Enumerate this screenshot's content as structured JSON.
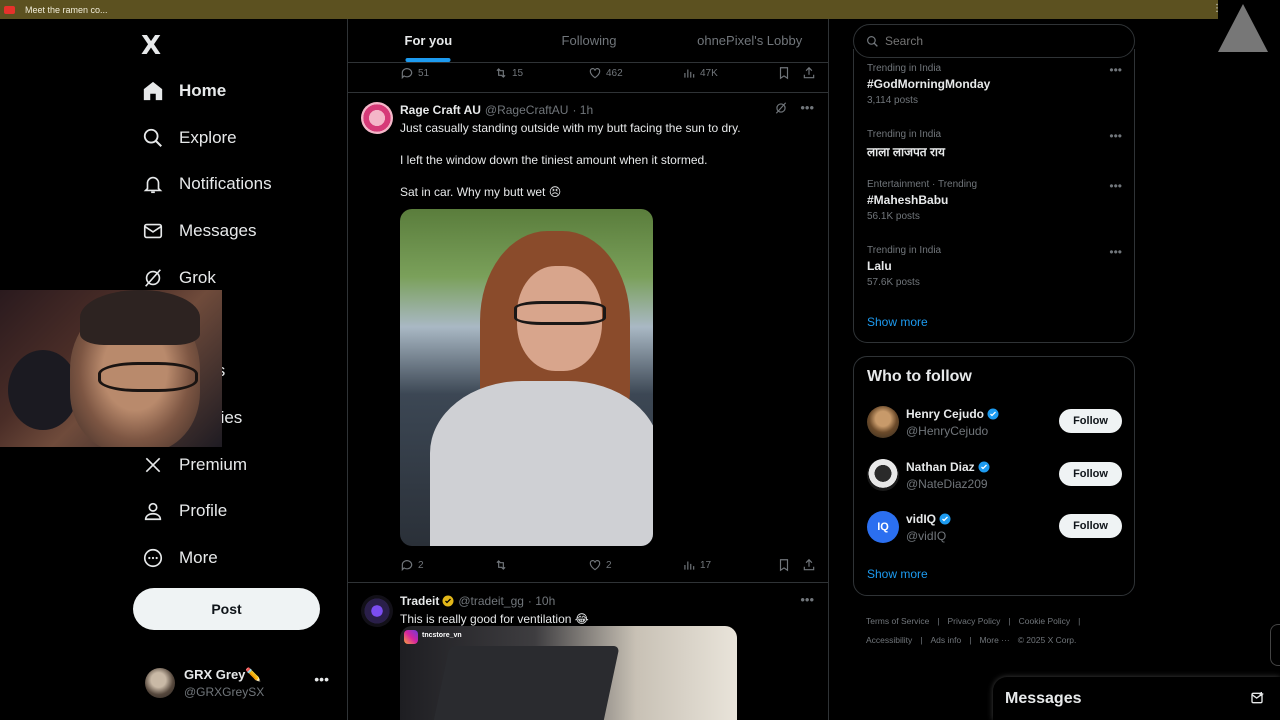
{
  "browser": {
    "tab_title": "Meet the ramen co..."
  },
  "nav": {
    "logo": "X",
    "items": [
      {
        "label": "Home",
        "icon": "home-icon"
      },
      {
        "label": "Explore",
        "icon": "search-icon"
      },
      {
        "label": "Notifications",
        "icon": "bell-icon"
      },
      {
        "label": "Messages",
        "icon": "mail-icon"
      },
      {
        "label": "Grok",
        "icon": "grok-icon"
      },
      {
        "label": "marks",
        "icon": "bookmark-icon"
      },
      {
        "label": "munities",
        "icon": "communities-icon"
      },
      {
        "label": "Premium",
        "icon": "x-icon"
      },
      {
        "label": "Profile",
        "icon": "person-icon"
      },
      {
        "label": "More",
        "icon": "more-circle-icon"
      }
    ],
    "post_label": "Post",
    "account": {
      "name": "GRX Grey✏️",
      "handle": "@GRXGreySX"
    }
  },
  "timeline": {
    "tabs": [
      "For you",
      "Following",
      "ohnePixel's Lobby"
    ],
    "prev_actions": {
      "replies": "51",
      "reposts": "15",
      "likes": "462",
      "views": "47K"
    },
    "tweets": [
      {
        "name": "Rage Craft AU",
        "handle": "@RageCraftAU",
        "time": "· 1h",
        "lines": [
          "Just casually standing outside with my butt facing the sun to dry.",
          "I left the window down the tiniest amount when it stormed.",
          "Sat in car. Why my butt wet 😣"
        ],
        "actions": {
          "replies": "2",
          "reposts": "",
          "likes": "2",
          "views": "17"
        }
      },
      {
        "name": "Tradeit",
        "handle": "@tradeit_gg",
        "time": "· 10h",
        "lines": [
          "This is really good for ventilation 😂"
        ],
        "media_label": "tncstore_vn"
      }
    ]
  },
  "sidebar": {
    "search_placeholder": "Search",
    "trends": [
      {
        "context": "Trending in India",
        "title": "#GodMorningMonday",
        "count": "3,114 posts"
      },
      {
        "context": "Trending in India",
        "title": "लाला लाजपत राय",
        "count": ""
      },
      {
        "context": "Entertainment · Trending",
        "title": "#MaheshBabu",
        "count": "56.1K posts"
      },
      {
        "context": "Trending in India",
        "title": "Lalu",
        "count": "57.6K posts"
      }
    ],
    "trends_show_more": "Show more",
    "who_to_follow": {
      "title": "Who to follow",
      "accounts": [
        {
          "name": "Henry Cejudo",
          "handle": "@HenryCejudo"
        },
        {
          "name": "Nathan Diaz",
          "handle": "@NateDiaz209"
        },
        {
          "name": "vidIQ",
          "handle": "@vidIQ"
        }
      ],
      "follow_label": "Follow",
      "show_more": "Show more"
    },
    "footer": {
      "row1": [
        "Terms of Service",
        "|",
        "Privacy Policy",
        "|",
        "Cookie Policy",
        "|"
      ],
      "row2": [
        "Accessibility",
        "|",
        "Ads info",
        "|",
        "More ···",
        "© 2025 X Corp."
      ]
    }
  },
  "dock": {
    "title": "Messages"
  },
  "colors": {
    "accent": "#1d9bf0",
    "verified": "#1d9bf0",
    "gold": "#e2b719",
    "text": "#e7e9ea",
    "muted": "#71767b"
  }
}
